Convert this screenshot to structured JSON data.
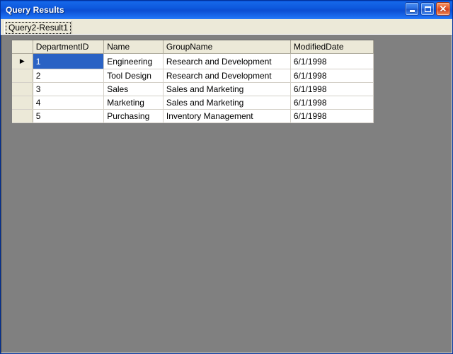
{
  "window": {
    "title": "Query Results",
    "buttons": [
      {
        "name": "minimize-button",
        "label": "_",
        "icon": "minimize-icon"
      },
      {
        "name": "maximize-button",
        "label": "□",
        "icon": "maximize-icon"
      },
      {
        "name": "close-button",
        "label": "✕",
        "icon": "close-icon"
      }
    ]
  },
  "tabs": [
    {
      "label": "Query2-Result1",
      "selected": true
    }
  ],
  "grid": {
    "row_indicator": "▶",
    "columns": [
      "DepartmentID",
      "Name",
      "GroupName",
      "ModifiedDate"
    ],
    "rows": [
      {
        "DepartmentID": "1",
        "Name": "Engineering",
        "GroupName": "Research and Development",
        "ModifiedDate": "6/1/1998",
        "selected_cell": "DepartmentID",
        "indicator": true
      },
      {
        "DepartmentID": "2",
        "Name": "Tool Design",
        "GroupName": "Research and Development",
        "ModifiedDate": "6/1/1998",
        "selected_cell": null,
        "indicator": false
      },
      {
        "DepartmentID": "3",
        "Name": "Sales",
        "GroupName": "Sales and Marketing",
        "ModifiedDate": "6/1/1998",
        "selected_cell": null,
        "indicator": false
      },
      {
        "DepartmentID": "4",
        "Name": "Marketing",
        "GroupName": "Sales and Marketing",
        "ModifiedDate": "6/1/1998",
        "selected_cell": null,
        "indicator": false
      },
      {
        "DepartmentID": "5",
        "Name": "Purchasing",
        "GroupName": "Inventory Management",
        "ModifiedDate": "6/1/1998",
        "selected_cell": null,
        "indicator": false
      }
    ]
  },
  "colors": {
    "titlebar_blue": "#0d58dd",
    "frame_blue": "#0a3ec8",
    "tab_beige": "#ece9d8",
    "client_gray": "#808080",
    "selection_blue": "#2a62c4",
    "close_red": "#e8572b",
    "grid_line": "#d4d0c8"
  }
}
